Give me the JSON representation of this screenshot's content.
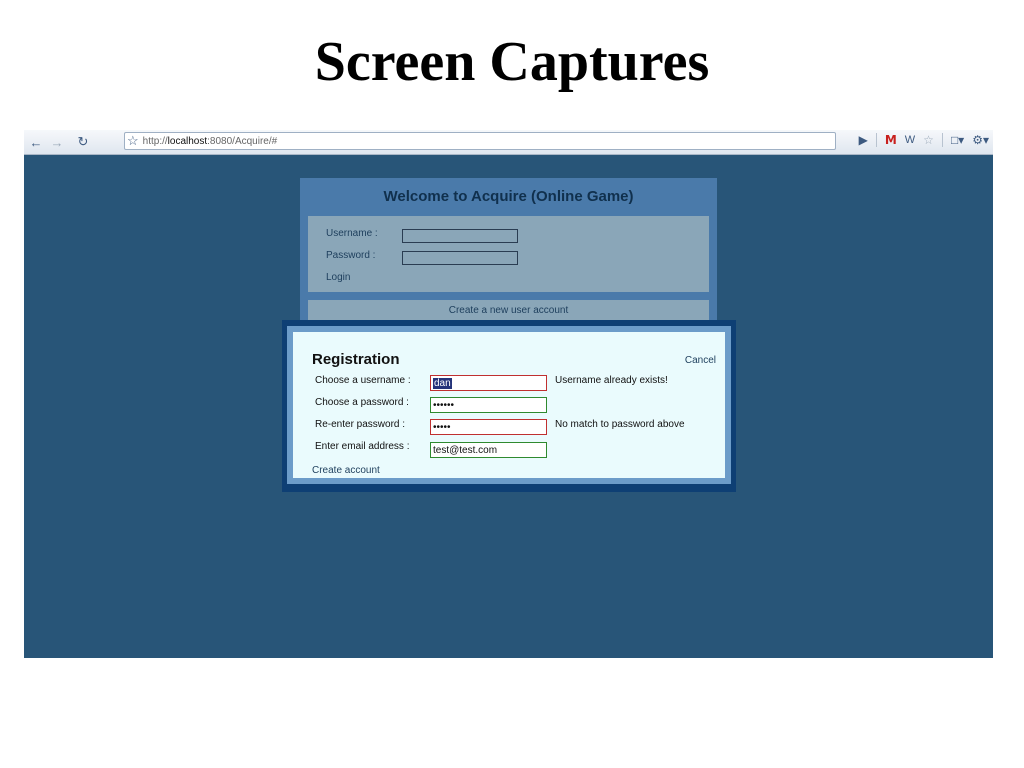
{
  "slide": {
    "title": "Screen Captures"
  },
  "browser": {
    "toolbar": {
      "back_icon": "arrow-left-icon",
      "forward_icon": "arrow-right-icon",
      "reload_icon": "reload-icon",
      "bookmark_icon": "star-icon",
      "url_prefix": "http://",
      "url_host": "localhost",
      "url_suffix": ":8080/Acquire/#",
      "right_icons": [
        "play-icon",
        "gmail-icon",
        "extension-icon",
        "star-icon",
        "page-menu-icon",
        "wrench-icon"
      ]
    }
  },
  "login": {
    "title": "Welcome to Acquire (Online Game)",
    "username_label": "Username :",
    "password_label": "Password :",
    "login_link": "Login",
    "create_account_link": "Create a new user account"
  },
  "registration": {
    "title": "Registration",
    "cancel": "Cancel",
    "username_label": "Choose a username :",
    "username_value": "dan",
    "username_message": "Username already exists!",
    "password_label": "Choose a password :",
    "password_value": "••••••",
    "reenter_label": "Re-enter password :",
    "reenter_value": "•••••",
    "reenter_message": "No match to password above",
    "email_label": "Enter email address :",
    "email_value": "test@test.com",
    "create_account": "Create account"
  },
  "colors": {
    "page_background": "#285578",
    "login_panel": "#4a7aaa",
    "modal_background": "#eafbfd",
    "error_border": "#c03030",
    "valid_border": "#2f8a2f"
  }
}
